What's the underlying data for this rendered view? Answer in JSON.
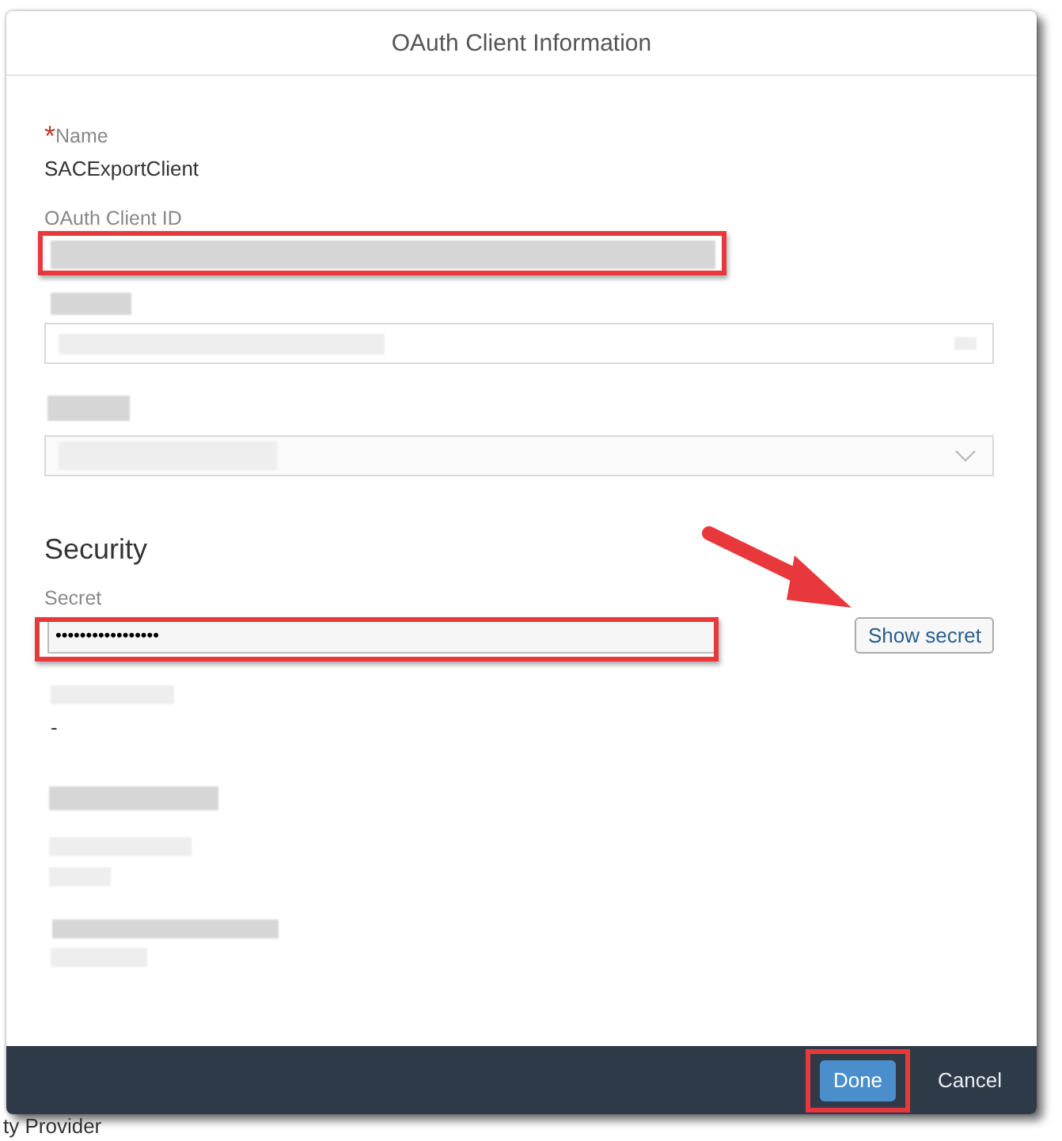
{
  "background": {
    "bottom_text": "ty Provider"
  },
  "dialog": {
    "title": "OAuth Client Information",
    "name_field": {
      "label": "Name",
      "required_mark": "*",
      "value": "SACExportClient"
    },
    "client_id_field": {
      "label": "OAuth Client ID"
    },
    "security": {
      "heading": "Security",
      "secret_label": "Secret",
      "secret_value": "•••••••••••••••••",
      "show_button": "Show secret"
    },
    "detail_value": "-",
    "footer": {
      "buttons": [
        {
          "label": "Done",
          "kind": "primary"
        },
        {
          "label": "Cancel",
          "kind": "plain"
        }
      ]
    }
  }
}
